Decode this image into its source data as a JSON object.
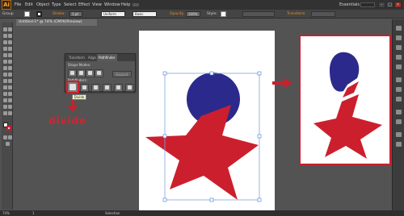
{
  "app": {
    "logo": "Ai"
  },
  "menu": {
    "items": [
      "File",
      "Edit",
      "Object",
      "Type",
      "Select",
      "Effect",
      "View",
      "Window",
      "Help"
    ],
    "workspace": "Essentials"
  },
  "control_bar": {
    "selection_label": "Group",
    "stroke_label": "Stroke:",
    "stroke_weight": "1 pt",
    "profile": "Uniform",
    "brush": "Basic",
    "opacity_label": "Opacity",
    "opacity_value": "100%",
    "style_label": "Style:",
    "transform_label": "Transform"
  },
  "document_tab": {
    "title": "Untitled-1* @ 74% (CMYK/Preview)"
  },
  "pathfinder": {
    "tabs": [
      "Transform",
      "Align",
      "Pathfinder"
    ],
    "shape_modes_label": "Shape Modes:",
    "pathfinders_label": "Pathfinders:",
    "expand_label": "Expand",
    "tooltip": "Divide"
  },
  "annotation": {
    "label": "divide"
  },
  "colors": {
    "circle": "#2b2a8c",
    "star": "#cc1f2d",
    "accent": "#c8202d"
  },
  "status": {
    "zoom": "74%",
    "page": "1",
    "mode": "Selection"
  }
}
